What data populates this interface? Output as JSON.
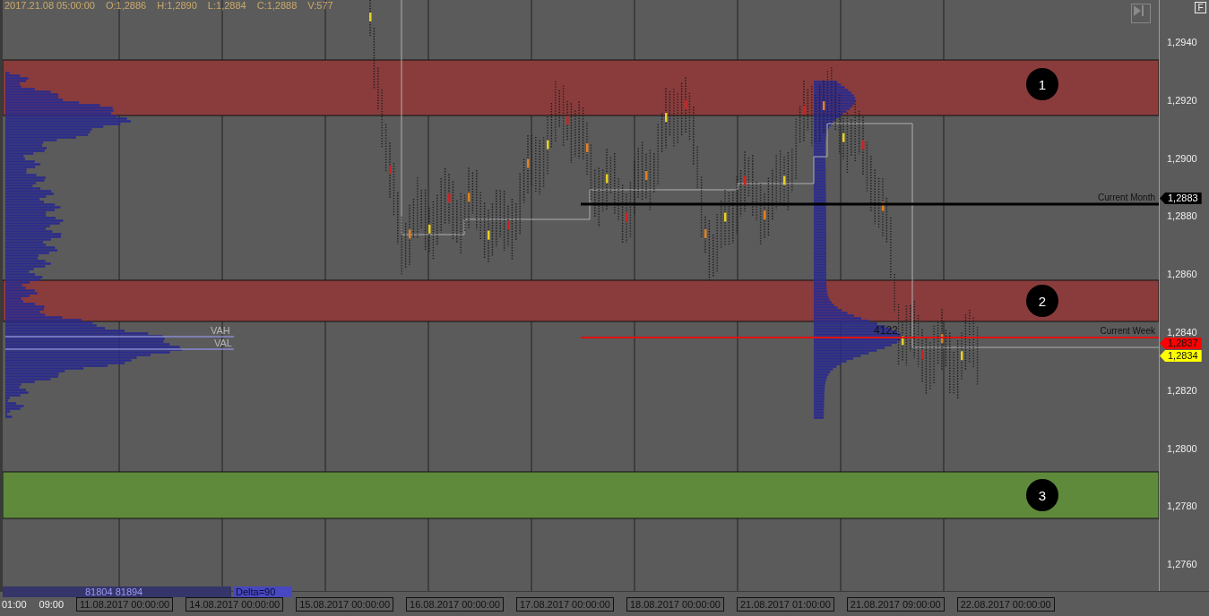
{
  "header": {
    "date": "2017.21.08 05:00:00",
    "open": "O:1,2886",
    "high": "H:1,2890",
    "low": "L:1,2884",
    "close": "C:1,2888",
    "volume": "V:577"
  },
  "toolbar": {
    "f_button": "F"
  },
  "zones": [
    {
      "label": "1",
      "color": "#8a3c3c"
    },
    {
      "label": "2",
      "color": "#8a3c3c"
    },
    {
      "label": "3",
      "color": "#5f8a3c"
    }
  ],
  "level_lines": [
    {
      "label": "Current Month",
      "color": "#000000"
    },
    {
      "label": "Current Week",
      "color": "#e01010"
    }
  ],
  "volume_profile": {
    "vah": "VAH",
    "val": "VAL",
    "poc_volume": "4122"
  },
  "price_axis": {
    "ticks": [
      "1,2940",
      "1,2920",
      "1,2900",
      "1,2880",
      "1,2860",
      "1,2840",
      "1,2820",
      "1,2800",
      "1,2780",
      "1,2760"
    ]
  },
  "price_markers": [
    {
      "value": "1,2883",
      "color": "#000000"
    },
    {
      "value": "1,2837",
      "color": "#ff0000"
    },
    {
      "value": "1,2834",
      "color": "#ffff00"
    }
  ],
  "footer": {
    "volume_text": "81804 81894",
    "delta": "Delta=90"
  },
  "time_axis": [
    {
      "kind": "tick",
      "label": "01:00"
    },
    {
      "kind": "tick",
      "label": "09:00"
    },
    {
      "kind": "date",
      "label": "11.08.2017 00:00:00"
    },
    {
      "kind": "date",
      "label": "14.08.2017 00:00:00"
    },
    {
      "kind": "date",
      "label": "15.08.2017 00:00:00"
    },
    {
      "kind": "date",
      "label": "16.08.2017 00:00:00"
    },
    {
      "kind": "date",
      "label": "17.08.2017 00:00:00"
    },
    {
      "kind": "date",
      "label": "18.08.2017 00:00:00"
    },
    {
      "kind": "date",
      "label": "21.08.2017 01:00:00"
    },
    {
      "kind": "date",
      "label": "21.08.2017 09:00:00"
    },
    {
      "kind": "date",
      "label": "22.08.2017 00:00:00"
    }
  ]
}
